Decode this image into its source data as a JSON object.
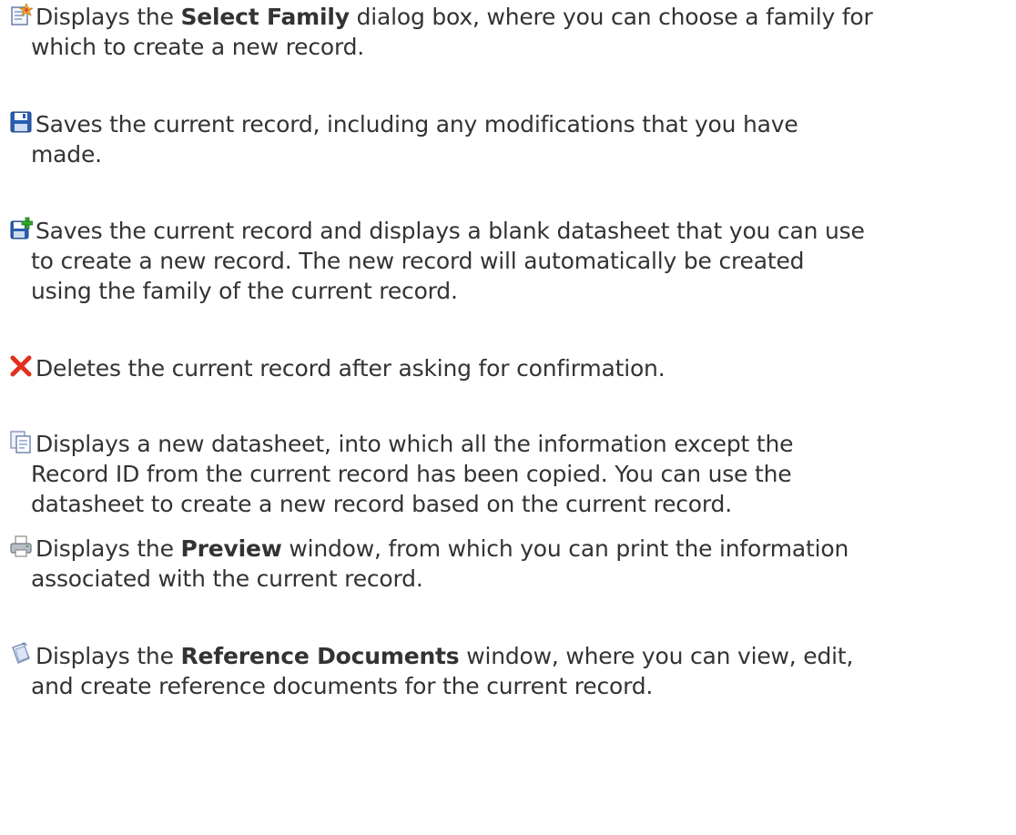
{
  "entries": [
    {
      "icon": "new-record-icon",
      "line1_pre": "Displays the ",
      "line1_bold": "Select Family",
      "line1_post": " dialog box, where you can choose a family for",
      "line2": "which to create a new record."
    },
    {
      "icon": "save-icon",
      "line1": "Saves the current record, including any modifications that you have",
      "line2": "made."
    },
    {
      "icon": "save-and-new-icon",
      "line1": "Saves the current record and displays a blank datasheet that you can use",
      "line2": "to create a new record. The new record will automatically be created",
      "line3": "using the family of the current record."
    },
    {
      "icon": "delete-icon",
      "line1": "Deletes the current record after asking for confirmation."
    },
    {
      "icon": "copy-icon",
      "line1": "Displays a new datasheet, into which all the information except the",
      "line2": "Record ID from the current record has been copied. You can use the",
      "line3": "datasheet to create a new record based on the current record."
    },
    {
      "icon": "print-icon",
      "line1_pre": "Displays the ",
      "line1_bold": "Preview",
      "line1_post": " window, from which you can print the information",
      "line2": "associated with the current record."
    },
    {
      "icon": "reference-documents-icon",
      "line1_pre": "Displays the ",
      "line1_bold": "Reference Documents",
      "line1_post": " window, where you can view, edit,",
      "line2": "and create reference documents for the current record."
    }
  ],
  "colors": {
    "text": "#333333",
    "delete_red": "#e0301e",
    "save_blue": "#2a5fb0",
    "add_green": "#2fa82f"
  }
}
